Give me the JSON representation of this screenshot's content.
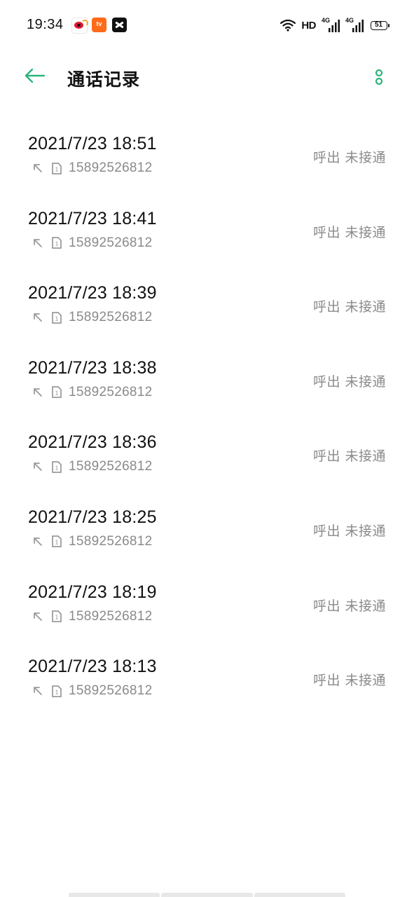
{
  "status_bar": {
    "time": "19:34",
    "apps": [
      "weibo-icon",
      "tv-app-icon",
      "capcut-icon"
    ],
    "tv_app_label": "tv",
    "hd": "HD",
    "network_1": "4G",
    "network_2": "4G",
    "battery": "51"
  },
  "header": {
    "title": "通话记录",
    "back_icon": "back-arrow-icon",
    "more_icon": "more-options-icon"
  },
  "colors": {
    "accent": "#2bb57a",
    "text_primary": "#111111",
    "text_secondary": "#8a8a8a",
    "background": "#ffffff"
  },
  "calls": [
    {
      "time": "2021/7/23 18:51",
      "direction_icon": "outgoing-call-icon",
      "sim": "1",
      "number": "15892526812",
      "status": "呼出 未接通"
    },
    {
      "time": "2021/7/23 18:41",
      "direction_icon": "outgoing-call-icon",
      "sim": "1",
      "number": "15892526812",
      "status": "呼出 未接通"
    },
    {
      "time": "2021/7/23 18:39",
      "direction_icon": "outgoing-call-icon",
      "sim": "1",
      "number": "15892526812",
      "status": "呼出 未接通"
    },
    {
      "time": "2021/7/23 18:38",
      "direction_icon": "outgoing-call-icon",
      "sim": "1",
      "number": "15892526812",
      "status": "呼出 未接通"
    },
    {
      "time": "2021/7/23 18:36",
      "direction_icon": "outgoing-call-icon",
      "sim": "1",
      "number": "15892526812",
      "status": "呼出 未接通"
    },
    {
      "time": "2021/7/23 18:25",
      "direction_icon": "outgoing-call-icon",
      "sim": "1",
      "number": "15892526812",
      "status": "呼出 未接通"
    },
    {
      "time": "2021/7/23 18:19",
      "direction_icon": "outgoing-call-icon",
      "sim": "1",
      "number": "15892526812",
      "status": "呼出 未接通"
    },
    {
      "time": "2021/7/23 18:13",
      "direction_icon": "outgoing-call-icon",
      "sim": "1",
      "number": "15892526812",
      "status": "呼出 未接通"
    }
  ]
}
